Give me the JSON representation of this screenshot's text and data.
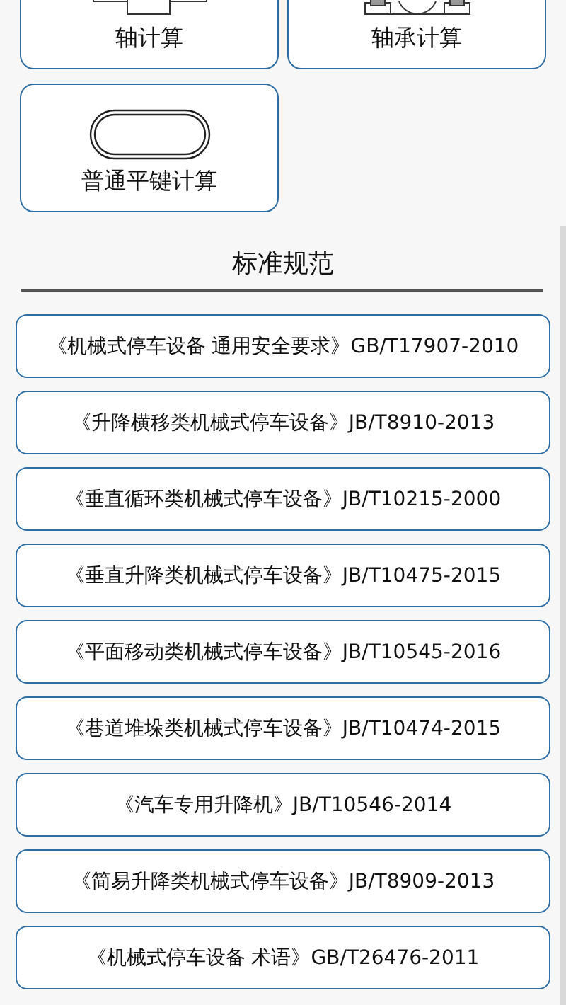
{
  "calculators": [
    {
      "label": "轴计算",
      "kind": "shaft"
    },
    {
      "label": "轴承计算",
      "kind": "bearing"
    },
    {
      "label": "普通平键计算",
      "kind": "key"
    }
  ],
  "standards_section": {
    "title": "标准规范",
    "items": [
      "《机械式停车设备 通用安全要求》GB/T17907-2010",
      "《升降横移类机械式停车设备》JB/T8910-2013",
      "《垂直循环类机械式停车设备》JB/T10215-2000",
      "《垂直升降类机械式停车设备》JB/T10475-2015",
      "《平面移动类机械式停车设备》JB/T10545-2016",
      "《巷道堆垛类机械式停车设备》JB/T10474-2015",
      "《汽车专用升降机》JB/T10546-2014",
      "《简易升降类机械式停车设备》JB/T8909-2013",
      "《机械式停车设备 术语》GB/T26476-2011"
    ]
  }
}
